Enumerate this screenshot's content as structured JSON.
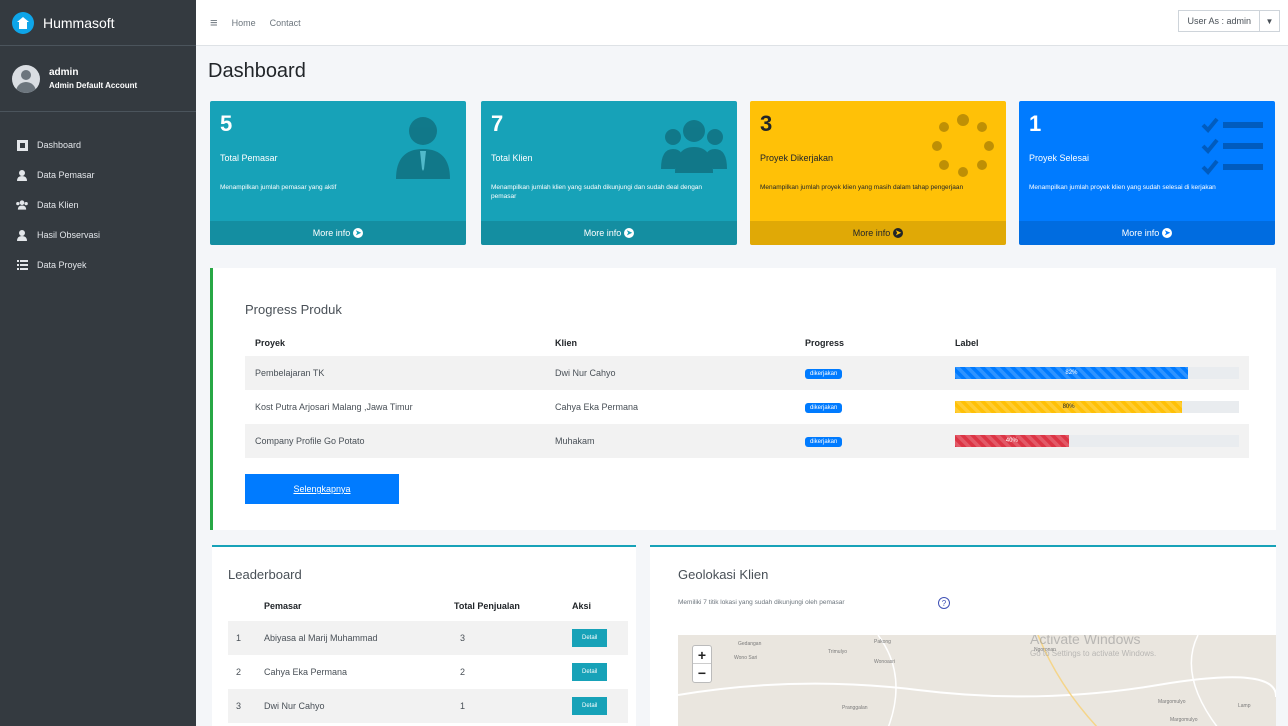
{
  "brand": {
    "name": "Hummasoft"
  },
  "user": {
    "name": "admin",
    "role": "Admin Default Account"
  },
  "sidebar": {
    "items": [
      {
        "label": "Dashboard",
        "icon": "dashboard-icon"
      },
      {
        "label": "Data Pemasar",
        "icon": "user-icon"
      },
      {
        "label": "Data Klien",
        "icon": "users-icon"
      },
      {
        "label": "Hasil Observasi",
        "icon": "user-icon"
      },
      {
        "label": "Data Proyek",
        "icon": "list-icon"
      }
    ]
  },
  "topbar": {
    "links": [
      "Home",
      "Contact"
    ],
    "user_as": "User As : admin"
  },
  "page": {
    "title": "Dashboard"
  },
  "stats": [
    {
      "count": "5",
      "title": "Total Pemasar",
      "desc": "Menampilkan jumlah pemasar yang aktif",
      "more": "More info",
      "color": "#17a2b8",
      "icon": "user-tie-icon"
    },
    {
      "count": "7",
      "title": "Total Klien",
      "desc": "Menampilkan jumlah klien yang sudah dikunjungi dan sudah deal dengan pemasar",
      "more": "More info",
      "color": "#17a2b8",
      "icon": "users-icon"
    },
    {
      "count": "3",
      "title": "Proyek Dikerjakan",
      "desc": "Menampilkan jumlah proyek klien yang masih dalam tahap pengerjaan",
      "more": "More info",
      "color": "#ffc107",
      "icon": "spinner-icon"
    },
    {
      "count": "1",
      "title": "Proyek Selesai",
      "desc": "Menampilkan jumlah proyek klien yang sudah selesai di kerjakan",
      "more": "More info",
      "color": "#007bff",
      "icon": "checklist-icon"
    }
  ],
  "progress": {
    "title": "Progress Produk",
    "headers": [
      "Proyek",
      "Klien",
      "Progress",
      "Label"
    ],
    "rows": [
      {
        "proyek": "Pembelajaran TK",
        "klien": "Dwi Nur Cahyo",
        "status": "dikerjakan",
        "percent": 82,
        "label": "82%",
        "color": "#007bff"
      },
      {
        "proyek": "Kost Putra Arjosari Malang ,Jawa Timur",
        "klien": "Cahya Eka Permana",
        "status": "dikerjakan",
        "percent": 80,
        "label": "80%",
        "color": "#ffc107"
      },
      {
        "proyek": "Company Profile Go Potato",
        "klien": "Muhakam",
        "status": "dikerjakan",
        "percent": 40,
        "label": "40%",
        "color": "#dc3545"
      }
    ],
    "more_button": "Selengkapnya"
  },
  "leaderboard": {
    "title": "Leaderboard",
    "headers": [
      "",
      "Pemasar",
      "Total Penjualan",
      "Aksi"
    ],
    "rows": [
      {
        "no": "1",
        "name": "Abiyasa al Marij Muhammad",
        "total": "3",
        "action": "Detail"
      },
      {
        "no": "2",
        "name": "Cahya Eka Permana",
        "total": "2",
        "action": "Detail"
      },
      {
        "no": "3",
        "name": "Dwi Nur Cahyo",
        "total": "1",
        "action": "Detail"
      }
    ]
  },
  "geo": {
    "title": "Geolokasi Klien",
    "subtitle": "Memiliki 7 titik lokasi yang sudah dikunjungi oleh pemasar",
    "help": "?",
    "zoom_in": "+",
    "zoom_out": "−",
    "map_labels": [
      "Gedangan",
      "Wono Sari",
      "Pakong",
      "Trimulyo",
      "Wonoasri",
      "Ngoronan",
      "Pranggalan",
      "Margomulyo",
      "Lamp",
      "Margomulyo"
    ],
    "watermark": "Activate Windows",
    "watermark_sub": "Go to Settings to activate Windows."
  }
}
